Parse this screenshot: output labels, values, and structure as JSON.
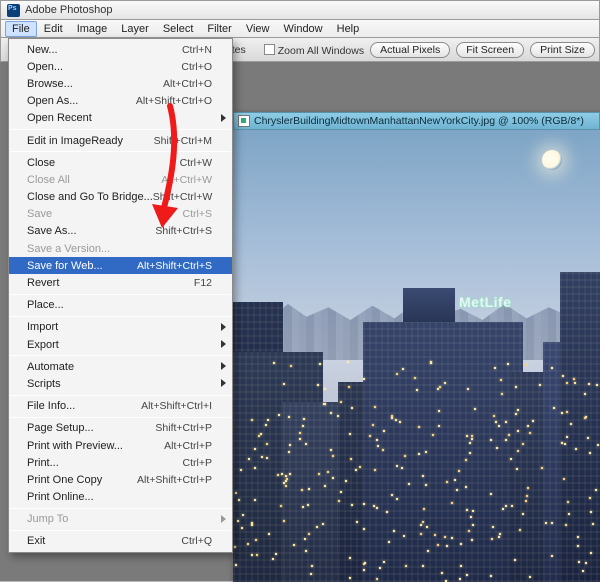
{
  "app": {
    "title": "Adobe Photoshop"
  },
  "menubar": [
    "File",
    "Edit",
    "Image",
    "Layer",
    "Select",
    "Filter",
    "View",
    "Window",
    "Help"
  ],
  "options": {
    "palettes_label": "Palettes",
    "zoom_all_label": "Zoom All Windows",
    "btn_actual": "Actual Pixels",
    "btn_fit": "Fit Screen",
    "btn_print": "Print Size"
  },
  "document": {
    "title": "ChryslerBuildingMidtownManhattanNewYorkCity.jpg @ 100% (RGB/8*)",
    "sign_text": "MetLife"
  },
  "menu": [
    {
      "type": "item",
      "label": "New...",
      "shortcut": "Ctrl+N"
    },
    {
      "type": "item",
      "label": "Open...",
      "shortcut": "Ctrl+O"
    },
    {
      "type": "item",
      "label": "Browse...",
      "shortcut": "Alt+Ctrl+O"
    },
    {
      "type": "item",
      "label": "Open As...",
      "shortcut": "Alt+Shift+Ctrl+O"
    },
    {
      "type": "item",
      "label": "Open Recent",
      "submenu": true
    },
    {
      "type": "sep"
    },
    {
      "type": "item",
      "label": "Edit in ImageReady",
      "shortcut": "Shift+Ctrl+M"
    },
    {
      "type": "sep"
    },
    {
      "type": "item",
      "label": "Close",
      "shortcut": "Ctrl+W"
    },
    {
      "type": "item",
      "label": "Close All",
      "shortcut": "Alt+Ctrl+W",
      "disabled": true
    },
    {
      "type": "item",
      "label": "Close and Go To Bridge...",
      "shortcut": "Shift+Ctrl+W"
    },
    {
      "type": "item",
      "label": "Save",
      "shortcut": "Ctrl+S",
      "disabled": true
    },
    {
      "type": "item",
      "label": "Save As...",
      "shortcut": "Shift+Ctrl+S"
    },
    {
      "type": "item",
      "label": "Save a Version...",
      "disabled": true
    },
    {
      "type": "item",
      "label": "Save for Web...",
      "shortcut": "Alt+Shift+Ctrl+S",
      "highlight": true
    },
    {
      "type": "item",
      "label": "Revert",
      "shortcut": "F12"
    },
    {
      "type": "sep"
    },
    {
      "type": "item",
      "label": "Place..."
    },
    {
      "type": "sep"
    },
    {
      "type": "item",
      "label": "Import",
      "submenu": true
    },
    {
      "type": "item",
      "label": "Export",
      "submenu": true
    },
    {
      "type": "sep"
    },
    {
      "type": "item",
      "label": "Automate",
      "submenu": true
    },
    {
      "type": "item",
      "label": "Scripts",
      "submenu": true
    },
    {
      "type": "sep"
    },
    {
      "type": "item",
      "label": "File Info...",
      "shortcut": "Alt+Shift+Ctrl+I"
    },
    {
      "type": "sep"
    },
    {
      "type": "item",
      "label": "Page Setup...",
      "shortcut": "Shift+Ctrl+P"
    },
    {
      "type": "item",
      "label": "Print with Preview...",
      "shortcut": "Alt+Ctrl+P"
    },
    {
      "type": "item",
      "label": "Print...",
      "shortcut": "Ctrl+P"
    },
    {
      "type": "item",
      "label": "Print One Copy",
      "shortcut": "Alt+Shift+Ctrl+P"
    },
    {
      "type": "item",
      "label": "Print Online..."
    },
    {
      "type": "sep"
    },
    {
      "type": "item",
      "label": "Jump To",
      "submenu": true,
      "disabled": true
    },
    {
      "type": "sep"
    },
    {
      "type": "item",
      "label": "Exit",
      "shortcut": "Ctrl+Q"
    }
  ]
}
